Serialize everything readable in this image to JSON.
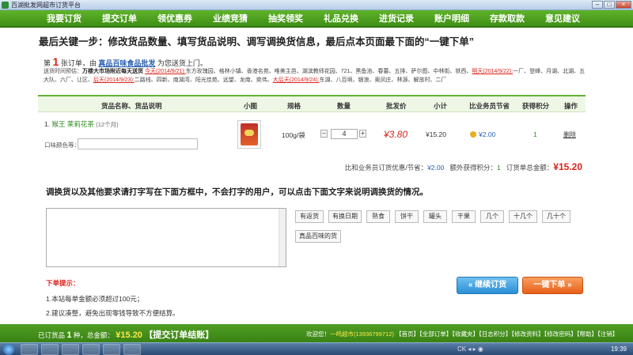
{
  "window": {
    "title": "百湖批发网超市订货平台",
    "controls": [
      "–",
      "□",
      "×"
    ]
  },
  "nav": {
    "items": [
      "我要订货",
      "提交订单",
      "领优惠券",
      "业绩竞猜",
      "抽奖领奖",
      "礼品兑换",
      "进货记录",
      "账户明细",
      "存款取款",
      "意见建议"
    ]
  },
  "step_title": "最后关键一步：修改货品数量、填写货品说明、调写调换货信息，最后点本页面最下面的“一键下单”",
  "order": {
    "prefix": "第",
    "number": "1",
    "middle": "张订单，由",
    "shop": "真品百味食品批发",
    "suffix": "为您送货上门。"
  },
  "delivery": {
    "label": "送货时间预估：",
    "bold": "万楼大市场附近每天送货",
    "today": "今天(2014/9/21):",
    "today_areas": "东方玫瑰园、格林小镇、香港名苑、唯美主邑、湖滨教师花园、721、黑鱼池、春蕾、五排、萨尔图、中林街、铁西、",
    "tomorrow": "明天(2014/9/22):",
    "tomorrow_areas": "一厂、登峰、月湖、北湖、五大队、六厂、让区、",
    "day_after": "后天(2014/9/23):",
    "day_after_areas": "二路线、四新、南湖湾、阳光佳苑、远望、龙南、奕伟、",
    "third": "大后天(2014/9/24):",
    "third_areas": "东湖、八百坰、银浪、奥凤庄、林源、解放村、二厂"
  },
  "table": {
    "headers": [
      "货品名称、货品说明",
      "小图",
      "规格",
      "数量",
      "批发价",
      "小计",
      "比业务员节省",
      "获得积分",
      "操作"
    ],
    "rows": [
      {
        "index": "1.",
        "brand": "猴王",
        "name": "茉莉花茶",
        "spec_note": "(12个月)",
        "flavor_label": "口味颜色等：",
        "spec": "100g/袋",
        "minus": "–",
        "qty": "4",
        "plus": "+",
        "price": "¥3.80",
        "subtotal": "¥15.20",
        "saving": "¥2.00",
        "points": "1",
        "action": "删除"
      }
    ]
  },
  "summary": {
    "saving_label": "比和业务员订货优惠/节省：",
    "saving": "¥2.00",
    "points_label": "额外获得积分：",
    "points": "1",
    "total_label": "订货单总金额：",
    "total": "¥15.20"
  },
  "exchange_hint": "调换货以及其他要求请打字写在下面方框中，不会打字的用户，可以点击下面文字来说明调换货的情况。",
  "chips": [
    "有返货",
    "有换日期",
    "熟食",
    "饼干",
    "罐头",
    "干果",
    "几个",
    "十几个",
    "几十个",
    "真品百味的货"
  ],
  "tips": {
    "title": "下单提示：",
    "items": [
      "1.本站每单金额必须超过100元；",
      "2.建议凑整，避免出现零钱导致不方便结算。"
    ]
  },
  "buttons": {
    "continue": "继续订货",
    "order": "一键下单"
  },
  "footer": {
    "ordered_label": "已订货品",
    "count": "1",
    "count_unit": "种，总金额：",
    "amount": "¥15.20",
    "submit": "【提交订单结账】",
    "welcome": "欢迎您！",
    "user": "一鸣超市(13936799712)",
    "links": "【首页】【全部订单】【收藏夹】【日志积分】【修改资料】【修改密码】【帮助】【注销】"
  },
  "taskbar": {
    "time": "19:39",
    "tray": "CK ◂ ▸ ◉"
  }
}
